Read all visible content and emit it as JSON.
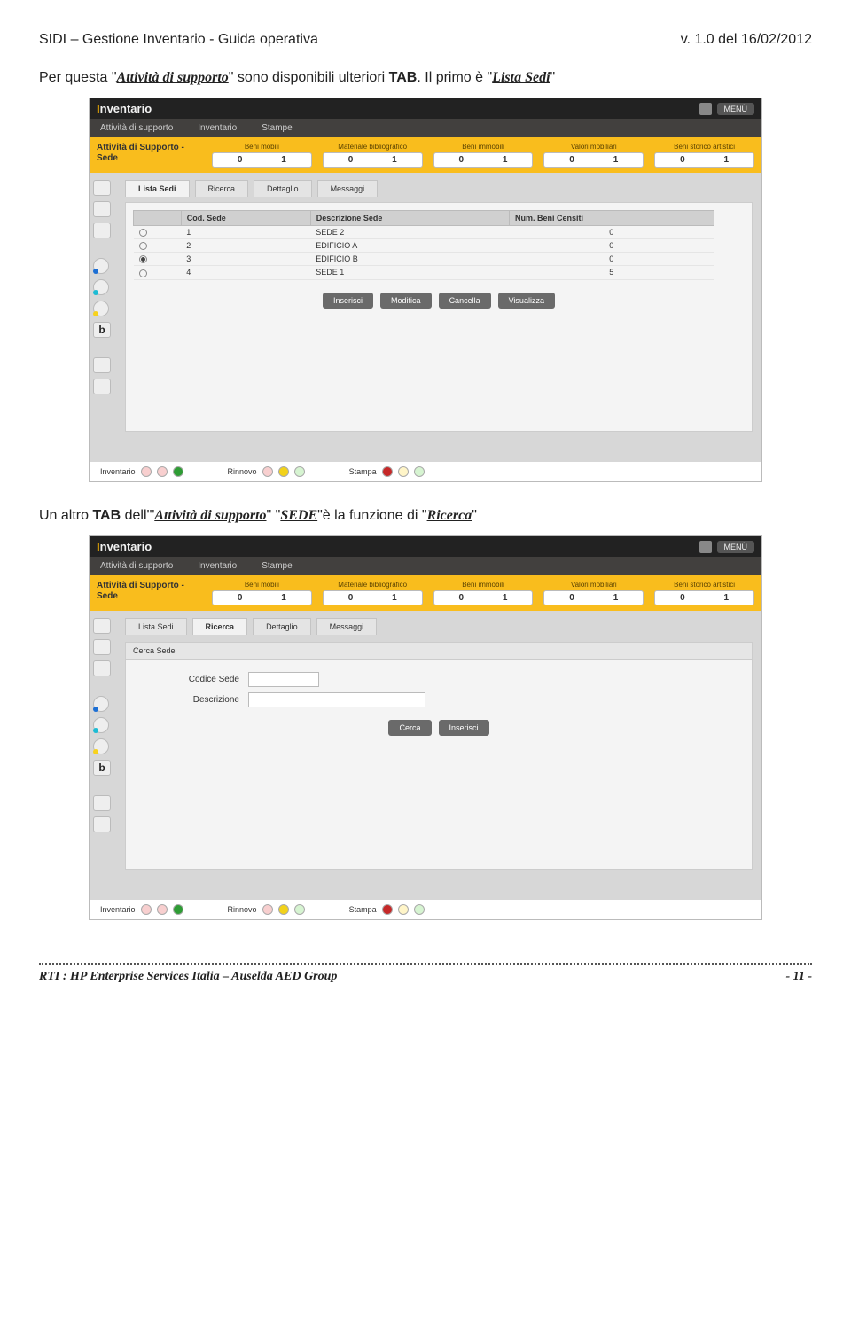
{
  "header": {
    "left": "SIDI – Gestione Inventario - Guida operativa",
    "right": "v. 1.0 del 16/02/2012"
  },
  "para1": {
    "prefix": "Per questa \"",
    "em1": "Attività di supporto",
    "mid1": "\" sono disponibili ulteriori ",
    "bold1": "TAB",
    "mid2": ". Il primo è \"",
    "em2": "Lista Sedi",
    "suffix": "\""
  },
  "para2": {
    "prefix": "Un altro ",
    "bold1": "TAB",
    "mid1": " dell'\"",
    "em1": "Attività di supporto",
    "mid2": "\" \"",
    "em2": "SEDE",
    "mid3": "\"è la funzione di \"",
    "em3": "Ricerca",
    "suffix": "\""
  },
  "footer": {
    "left": "RTI : HP Enterprise Services Italia – Auselda AED Group",
    "right": "- 11 -"
  },
  "app": {
    "logo_pre": "I",
    "logo_accent": "I",
    "logo_rest": "nventario",
    "menu": "MENÙ",
    "nav": [
      "Attività di supporto",
      "Inventario",
      "Stampe"
    ],
    "yb_label": "Attività di Supporto - Sede",
    "yb_items": [
      {
        "cap": "Beni mobili",
        "a": "0",
        "b": "1"
      },
      {
        "cap": "Materiale bibliografico",
        "a": "0",
        "b": "1"
      },
      {
        "cap": "Beni immobili",
        "a": "0",
        "b": "1"
      },
      {
        "cap": "Valori mobiliari",
        "a": "0",
        "b": "1"
      },
      {
        "cap": "Beni storico artistici",
        "a": "0",
        "b": "1"
      }
    ],
    "tabs1": [
      "Lista Sedi",
      "Ricerca",
      "Dettaglio",
      "Messaggi"
    ],
    "table_headers": [
      "",
      "Cod. Sede",
      "Descrizione Sede",
      "Num. Beni Censiti"
    ],
    "rows": [
      {
        "sel": false,
        "cod": "1",
        "desc": "SEDE 2",
        "num": "0"
      },
      {
        "sel": false,
        "cod": "2",
        "desc": "EDIFICIO A",
        "num": "0"
      },
      {
        "sel": true,
        "cod": "3",
        "desc": "EDIFICIO B",
        "num": "0"
      },
      {
        "sel": false,
        "cod": "4",
        "desc": "SEDE 1",
        "num": "5"
      }
    ],
    "actions": [
      "Inserisci",
      "Modifica",
      "Cancella",
      "Visualizza"
    ],
    "status": [
      {
        "label": "Inventario",
        "dots": [
          "d-pink",
          "d-pink",
          "d-green"
        ]
      },
      {
        "label": "Rinnovo",
        "dots": [
          "d-pink",
          "d-yel",
          "d-lg"
        ]
      },
      {
        "label": "Stampa",
        "dots": [
          "d-red",
          "d-ly",
          "d-lg"
        ]
      }
    ],
    "tabs2": [
      "Lista Sedi",
      "Ricerca",
      "Dettaglio",
      "Messaggi"
    ],
    "panel2_title": "Cerca Sede",
    "form": {
      "f1_label": "Codice Sede",
      "f2_label": "Descrizione",
      "actions": [
        "Cerca",
        "Inserisci"
      ]
    }
  }
}
